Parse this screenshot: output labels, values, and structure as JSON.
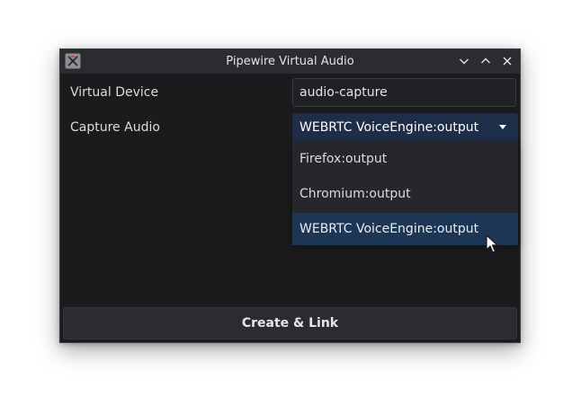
{
  "window": {
    "title": "Pipewire Virtual Audio"
  },
  "form": {
    "virtual_device_label": "Virtual Device",
    "virtual_device_value": "audio-capture",
    "capture_audio_label": "Capture Audio",
    "capture_audio_selected": "WEBRTC VoiceEngine:output"
  },
  "dropdown": {
    "options": [
      "Firefox:output",
      "Chromium:output",
      "WEBRTC VoiceEngine:output"
    ]
  },
  "actions": {
    "create_link_label": "Create & Link"
  },
  "colors": {
    "window_bg": "#1b1b1e",
    "titlebar_bg": "#2b2c31",
    "combo_bg": "#1e2d48",
    "highlight_bg": "#1e3656"
  }
}
